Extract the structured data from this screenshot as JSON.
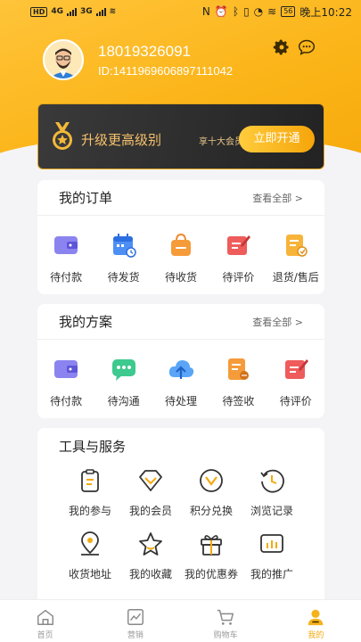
{
  "status_bar": {
    "left": "HD 4G 3G",
    "time": "晚上10:22",
    "battery": "56"
  },
  "profile": {
    "phone": "18019326091",
    "id": "ID:1411969606897111042"
  },
  "vip": {
    "title": "升级更高级别",
    "subtitle": "享十大会员权益",
    "button": "立即开通"
  },
  "orders": {
    "title": "我的订单",
    "view_all": "查看全部 >",
    "items": [
      {
        "label": "待付款",
        "icon": "wallet-icon"
      },
      {
        "label": "待发货",
        "icon": "calendar-icon"
      },
      {
        "label": "待收货",
        "icon": "bag-icon"
      },
      {
        "label": "待评价",
        "icon": "review-icon"
      },
      {
        "label": "退货/售后",
        "icon": "refund-icon"
      }
    ]
  },
  "plans": {
    "title": "我的方案",
    "view_all": "查看全部 >",
    "items": [
      {
        "label": "待付款",
        "icon": "wallet-icon"
      },
      {
        "label": "待沟通",
        "icon": "message-icon"
      },
      {
        "label": "待处理",
        "icon": "cloud-upload-icon"
      },
      {
        "label": "待签收",
        "icon": "document-icon"
      },
      {
        "label": "待评价",
        "icon": "review-icon"
      }
    ]
  },
  "tools": {
    "title": "工具与服务",
    "items": [
      {
        "label": "我的参与",
        "icon": "clipboard-icon"
      },
      {
        "label": "我的会员",
        "icon": "diamond-icon"
      },
      {
        "label": "积分兑换",
        "icon": "check-circle-icon"
      },
      {
        "label": "浏览记录",
        "icon": "history-icon"
      },
      {
        "label": "收货地址",
        "icon": "location-icon"
      },
      {
        "label": "我的收藏",
        "icon": "star-icon"
      },
      {
        "label": "我的优惠券",
        "icon": "gift-icon"
      },
      {
        "label": "我的推广",
        "icon": "chart-icon"
      }
    ]
  },
  "tabbar": [
    {
      "label": "首页",
      "icon": "home-icon"
    },
    {
      "label": "营销",
      "icon": "trend-icon"
    },
    {
      "label": "购物车",
      "icon": "cart-icon"
    },
    {
      "label": "我的",
      "icon": "profile-icon",
      "active": true
    }
  ],
  "colors": {
    "accent": "#f5a90f",
    "vip_bg": "#262626",
    "text": "#222222"
  }
}
